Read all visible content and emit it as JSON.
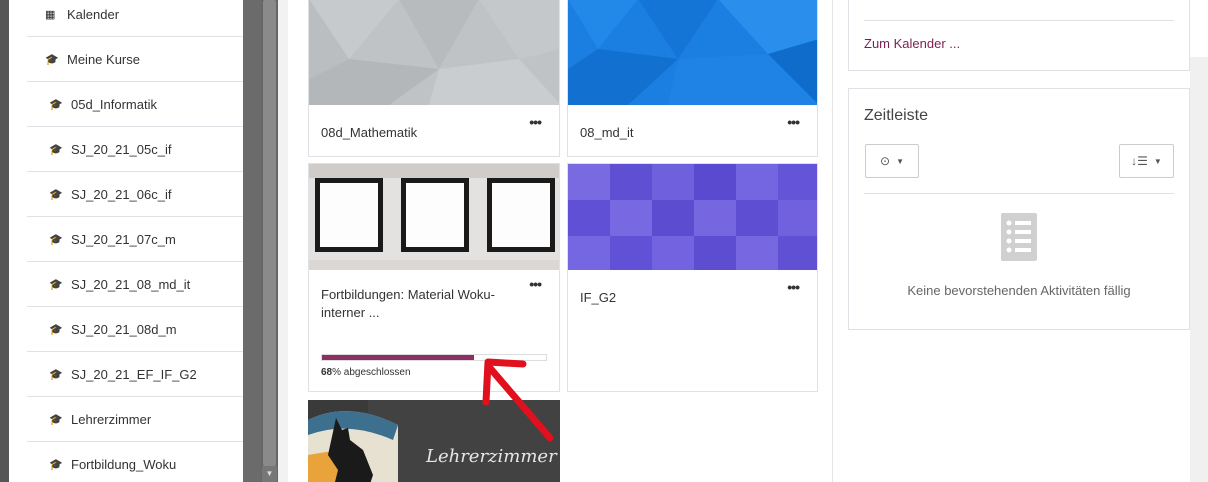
{
  "sidebar": {
    "top_items": [
      {
        "label": "Kalender",
        "icon": "calendar-icon"
      },
      {
        "label": "Meine Kurse",
        "icon": "graduation-cap-icon"
      }
    ],
    "courses": [
      "05d_Informatik",
      "SJ_20_21_05c_if",
      "SJ_20_21_06c_if",
      "SJ_20_21_07c_m",
      "SJ_20_21_08_md_it",
      "SJ_20_21_08d_m",
      "SJ_20_21_EF_IF_G2",
      "Lehrerzimmer",
      "Fortbildung_Woku"
    ]
  },
  "cards": [
    {
      "title": "08d_Mathematik",
      "menu": "•••"
    },
    {
      "title": "08_md_it",
      "menu": "•••"
    },
    {
      "title": "Fortbildungen: Material Woku-interner ...",
      "menu": "•••",
      "progress_percent": 68,
      "progress_suffix": "% abgeschlossen"
    },
    {
      "title": "IF_G2",
      "menu": "•••"
    },
    {
      "image_text": "Lehrerzimmer"
    }
  ],
  "calendar_panel": {
    "link": "Zum Kalender ..."
  },
  "timeline": {
    "title": "Zeitleiste",
    "empty_message": "Keine bevorstehenden Aktivitäten fällig"
  },
  "colors": {
    "accent": "#8d2f63",
    "link": "#7a1f52",
    "blue_tile": "#1a7fe0",
    "purple_tile": "#6b5bdc",
    "annotation_arrow": "#e0101e"
  }
}
